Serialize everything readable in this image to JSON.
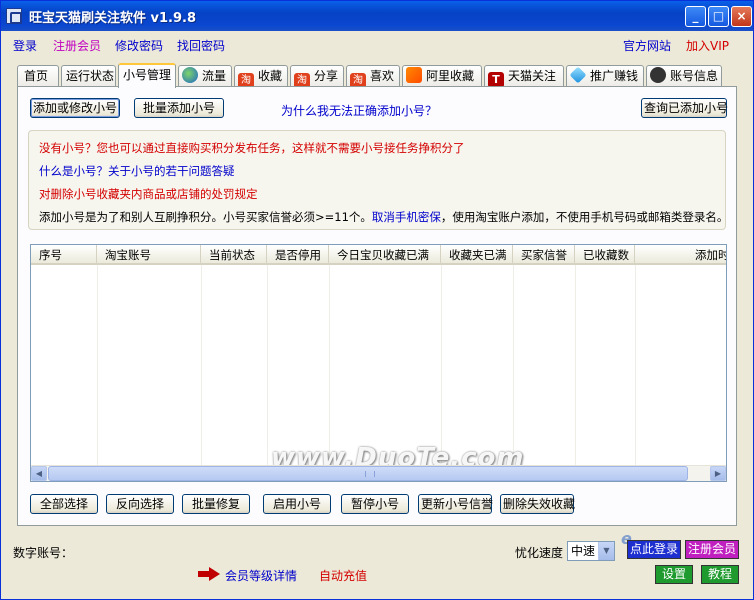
{
  "window": {
    "title": "旺宝天猫刷关注软件  v1.9.8",
    "min": "_",
    "max": "□",
    "close": "×"
  },
  "menu": {
    "login": "登录",
    "register": "注册会员",
    "change_pwd": "修改密码",
    "recover_pwd": "找回密码",
    "website": "官方网站",
    "vip": "加入VIP"
  },
  "tabs": [
    {
      "label": "首页"
    },
    {
      "label": "运行状态"
    },
    {
      "label": "小号管理"
    },
    {
      "label": "流量"
    },
    {
      "label": "收藏"
    },
    {
      "label": "分享"
    },
    {
      "label": "喜欢"
    },
    {
      "label": "阿里收藏"
    },
    {
      "label": "天猫关注"
    },
    {
      "label": "推广赚钱"
    },
    {
      "label": "账号信息"
    }
  ],
  "toolbar": {
    "add_modify": "添加或修改小号",
    "batch_add": "批量添加小号",
    "why_link": "为什么我无法正确添加小号？",
    "query_added": "查询已添加小号"
  },
  "info": {
    "line1": "没有小号？您也可以通过直接购买积分发布任务，这样就不需要小号接任务挣积分了",
    "line2": "什么是小号？关于小号的若干问题答疑",
    "line3": "对删除小号收藏夹内商品或店铺的处罚规定",
    "line4_a": "添加小号是为了和别人互刷挣积分。小号买家信誉必须>=11个。",
    "line4_link": "取消手机密保",
    "line4_b": "，使用淘宝账户添加，不使用手机号码或邮箱类登录名。"
  },
  "grid": {
    "columns": [
      "序号",
      "淘宝账号",
      "当前状态",
      "是否停用",
      "今日宝贝收藏已满",
      "收藏夹已满",
      "买家信誉",
      "已收藏数",
      "添加时"
    ],
    "rows": []
  },
  "watermark": "www.DuoTe.com",
  "actions": {
    "select_all": "全部选择",
    "invert": "反向选择",
    "batch_fix": "批量修复",
    "enable": "启用小号",
    "pause": "暂停小号",
    "update_credit": "更新小号信誉",
    "delete_invalid": "删除失效收藏"
  },
  "status": {
    "digit_account_label": "数字账号：",
    "speed_label": "忧化速度",
    "speed_value": "中速",
    "member_detail": "会员等级详情",
    "auto_recharge": "自动充值",
    "login_btn": "点此登录",
    "register_btn": "注册会员",
    "settings_btn": "设置",
    "tutorial_btn": "教程"
  },
  "colors": {
    "accent_link": "#0000ee",
    "red_text": "#d40000",
    "pink_menu": "#c000c0",
    "login_btn": "#1e2fd0",
    "register_btn": "#c020c0",
    "settings_btn": "#1f9a2e",
    "tutorial_btn": "#1f9a2e"
  },
  "icons": {
    "traffic": "globe-icon",
    "favorite": "taobao-icon",
    "share": "taobao-icon",
    "like": "taobao-icon",
    "ali": "ali-icon",
    "tmall": "tmall-icon",
    "promote": "diamond-icon",
    "account": "account-icon"
  }
}
